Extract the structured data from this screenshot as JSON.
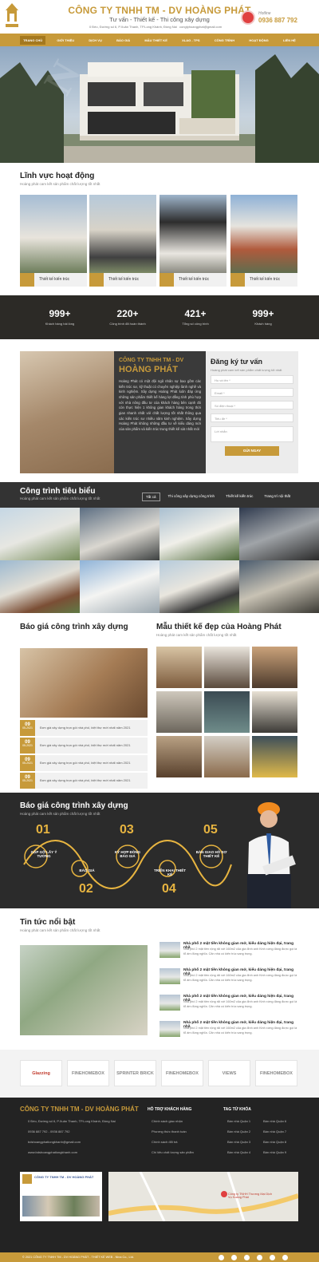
{
  "header": {
    "company": "CÔNG TY TNHH TM - DV HOÀNG PHÁT",
    "slogan": "Tư vấn - Thiết kế - Thi công xây dựng",
    "address": "0 Đèo, Đường số 6, P.Xuân Thanh, TP.Long Khánh, Đồng Nai",
    "email": "congtyhoangphat@gmail.com",
    "hotline_label": "Hotline",
    "hotline": "0936 887 792",
    "logo_text": "HOÀNG PHÁT"
  },
  "nav": [
    "TRANG CHỦ",
    "GIỚI THIỆU",
    "DỊCH VỤ",
    "BÁO GIÁ",
    "MẪU THIẾT KẾ",
    "XLAG - TPS",
    "CÔNG TRÌNH",
    "HOẠT ĐỘNG",
    "LIÊN HỆ"
  ],
  "fields": {
    "title": "Lĩnh vực hoạt động",
    "subtitle": "Hoàng phát cam kết sản phẩm chất lượng tốt nhất",
    "cards": [
      "Thiết kế kiến trúc",
      "Thiết kế kiến trúc",
      "Thiết kế kiến trúc",
      "Thiết kế kiến trúc"
    ]
  },
  "stats": [
    {
      "n": "999+",
      "l": "Khách hàng hài lòng"
    },
    {
      "n": "220+",
      "l": "Công trình đã hoàn thành"
    },
    {
      "n": "421+",
      "l": "Tổng số công trình"
    },
    {
      "n": "999+",
      "l": "Khách hàng"
    }
  ],
  "intro": {
    "line1": "CÔNG TY TNHH TM - DV",
    "line2": "HOÀNG PHÁT",
    "text": "Hoàng Phát có một đội ngũ nhân sự bao gồm các kiến trúc sư, kỹ thuật có chuyên nghiệp lành nghề và kinh nghiệm. Xây dựng Hoàng Phát luôn đáp ứng những sản phẩm thiết kế hàng lọt đẳng tính phù hợp với nhà nông đầu tư của khách hàng bên cạnh đó còn thực hiện 1 không gian khách hàng trong thời gian nhanh nhất với chất lượng tốt nhất thông qua các kiến trúc sư nhiều năm kinh nghiệm. Xây dựng Hoàng Phát không những đầu tư về kiểu dáng mới của sản phẩm và kiến trúc trung thiết kế sát nhất mới"
  },
  "form": {
    "title": "Đăng ký tư vấn",
    "subtitle": "Hoàng phát cam kết sản phẩm chất lượng tốt nhất",
    "fields": [
      "Họ và tên *",
      "Email *",
      "Số điện thoại *",
      "Tiêu đề *",
      "Lời nhắn"
    ],
    "button": "GỬI NGAY"
  },
  "projects": {
    "title": "Công trình tiêu biểu",
    "subtitle": "Hoàng phát cam kết sản phẩm chất lượng tốt nhất",
    "tabs": [
      "Tất cả",
      "Thi công xây dựng công trình",
      "Thiết kế kiến trúc",
      "Trang trí nội thất"
    ]
  },
  "quotes": {
    "title": "Báo giá công trình xây dựng",
    "rows": [
      {
        "d": "09",
        "m": "05-2021",
        "t": "Đơn giá xây dựng trọn gói nhà phố, biệt thự mới nhất năm 2021"
      },
      {
        "d": "09",
        "m": "05-2021",
        "t": "Đơn giá xây dựng trọn gói nhà phố, biệt thự mới nhất năm 2021"
      },
      {
        "d": "09",
        "m": "05-2021",
        "t": "Đơn giá xây dựng trọn gói nhà phố, biệt thự mới nhất năm 2021"
      },
      {
        "d": "09",
        "m": "05-2021",
        "t": "Đơn giá xây dựng trọn gói nhà phố, biệt thự mới nhất năm 2021"
      }
    ]
  },
  "designs": {
    "title": "Mẫu thiết kế đẹp của Hoàng Phát",
    "subtitle": "Hoàng phát cam kết sản phẩm chất lượng tốt nhất"
  },
  "process": {
    "title": "Báo giá công trình xây dựng",
    "subtitle": "Hoàng phát cam kết sản phẩm chất lượng tốt nhất",
    "steps": [
      {
        "n": "01",
        "l": "GẶP GỠ LẤY Ý TƯỞNG"
      },
      {
        "n": "02",
        "l": "BÁO GIÁ"
      },
      {
        "n": "03",
        "l": "KÝ HỢP ĐỒNG BÁO GIÁ"
      },
      {
        "n": "04",
        "l": "TRIỂN KHAI THIẾT KẾ"
      },
      {
        "n": "05",
        "l": "BÀN GIAO HỒ SƠ THIẾT KẾ"
      }
    ]
  },
  "news": {
    "title": "Tin tức nổi bật",
    "subtitle": "Hoàng phát cam kết sản phẩm chất lượng tốt nhất",
    "items": [
      {
        "h": "Nhà phố 2 mặt tiền không gian mở, kiểu dáng hiện đại, trang nhã",
        "p": "Nhà phố 2 mặt tiền rộng rãi với 160m2 của gia đình anh Kinh xứng đáng được gọi là tổ ấm đúng nghĩa. Căn nhà có kiến trúc sang trọng."
      },
      {
        "h": "Nhà phố 2 mặt tiền không gian mở, kiểu dáng hiện đại, trang nhã",
        "p": "Nhà phố 2 mặt tiền rộng rãi với 160m2 của gia đình anh Kinh xứng đáng được gọi là tổ ấm đúng nghĩa. Căn nhà có kiến trúc sang trọng."
      },
      {
        "h": "Nhà phố 2 mặt tiền không gian mở, kiểu dáng hiện đại, trang nhã",
        "p": "Nhà phố 2 mặt tiền rộng rãi với 160m2 của gia đình anh Kinh xứng đáng được gọi là tổ ấm đúng nghĩa. Căn nhà có kiến trúc sang trọng."
      },
      {
        "h": "Nhà phố 2 mặt tiền không gian mở, kiểu dáng hiện đại, trang nhã",
        "p": "Nhà phố 2 mặt tiền rộng rãi với 160m2 của gia đình anh Kinh xứng đáng được gọi là tổ ấm đúng nghĩa. Căn nhà có kiến trúc sang trọng."
      }
    ]
  },
  "partners": [
    "Glazzing",
    "FINEHOMEBOX",
    "SPRINTER BRICK",
    "FINEHOMEBOX",
    "VIEWS",
    "FINEHOMEBOX"
  ],
  "footer": {
    "company": "CÔNG TY TNHH TM - DV HOÀNG PHÁT",
    "address": "0 Đèo, Đường số 6, P.Xuân Thanh, TP.Long Khánh, Đồng Nai",
    "phone": "0936 887 792 - 0936 887 792",
    "email": "bdshoangphatlongkhanh@gmail.com",
    "web": "www.bdshoangphatlongkhanh.com",
    "support_title": "HỖ TRỢ KHÁCH HÀNG",
    "support": [
      "Chính sách giao nhận",
      "Phương thức thanh toán",
      "Chính sách đổi trả",
      "Chí tiêu chất lượng sản phẩm"
    ],
    "tags_title": "TAG TỪ KHÓA",
    "tags": [
      "Bán nhà Quận 1",
      "Bán nhà Quận 6",
      "Bán nhà Quận 2",
      "Bán nhà Quận 7",
      "Bán nhà Quận 3",
      "Bán nhà Quận 8",
      "Bán nhà Quận 4",
      "Bán nhà Quận 9"
    ],
    "fb_name": "CÔNG TY TNHH TM - DV HOÀNG PHÁT",
    "map_label": "Công ty TNHH Thương Mại Dịch Vụ Hoàng Phát",
    "copyright": "© 2021 CÔNG TY TNHH TM - DV HOÀNG PHÁT - THIẾT KẾ WEB - Nina Co., Ltd."
  },
  "colors": {
    "brand": "#c79a3a",
    "dark": "#2b2b2b"
  }
}
